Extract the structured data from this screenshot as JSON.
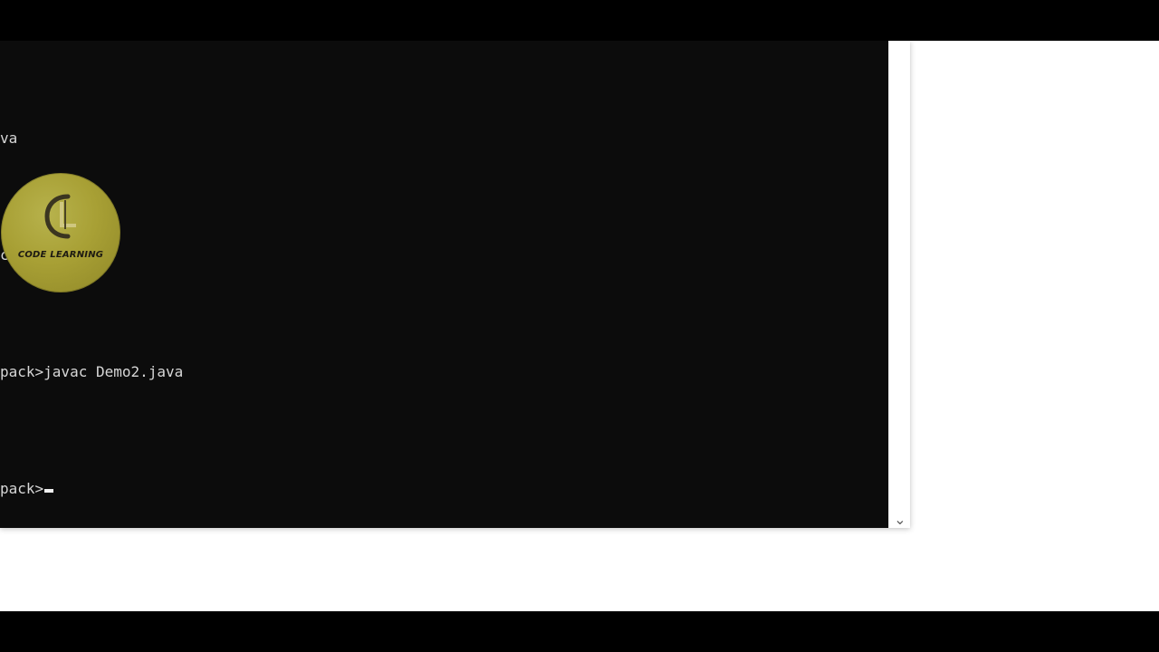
{
  "console": {
    "lines": [
      "va",
      "cd pack",
      "pack>javac Demo2.java",
      "pack>"
    ]
  },
  "watermark": {
    "logo_text": "CODE LEARNING"
  },
  "icons": {
    "scroll_down": "chevron-down-icon"
  },
  "colors": {
    "console_background": "#0c0c0c",
    "console_text": "#d7d7d7",
    "logo_gold": "#a8a035",
    "scrollbar": "#ffffff"
  }
}
